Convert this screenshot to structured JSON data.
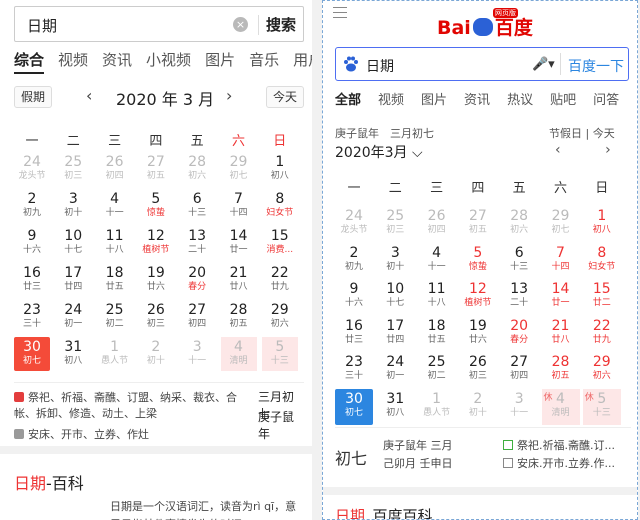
{
  "left": {
    "search": {
      "query": "日期",
      "clear_icon": "×",
      "button": "搜索"
    },
    "tabs": [
      "综合",
      "视频",
      "资讯",
      "小视频",
      "图片",
      "音乐",
      "用户"
    ],
    "calendar": {
      "holiday_button": "假期",
      "month_label": "2020 年 3 月",
      "prev": "‹",
      "next": "›",
      "today_button": "今天",
      "weekdays": [
        "一",
        "二",
        "三",
        "四",
        "五",
        "六",
        "日"
      ],
      "days": [
        {
          "n": "24",
          "s": "龙头节",
          "gray": true
        },
        {
          "n": "25",
          "s": "初三",
          "gray": true
        },
        {
          "n": "26",
          "s": "初四",
          "gray": true
        },
        {
          "n": "27",
          "s": "初五",
          "gray": true
        },
        {
          "n": "28",
          "s": "初六",
          "gray": true
        },
        {
          "n": "29",
          "s": "初七",
          "gray": true
        },
        {
          "n": "1",
          "s": "初八"
        },
        {
          "n": "2",
          "s": "初九"
        },
        {
          "n": "3",
          "s": "初十"
        },
        {
          "n": "4",
          "s": "十一"
        },
        {
          "n": "5",
          "s": "惊蛰",
          "sred": true
        },
        {
          "n": "6",
          "s": "十三"
        },
        {
          "n": "7",
          "s": "十四"
        },
        {
          "n": "8",
          "s": "妇女节",
          "sred": true
        },
        {
          "n": "9",
          "s": "十六"
        },
        {
          "n": "10",
          "s": "十七"
        },
        {
          "n": "11",
          "s": "十八"
        },
        {
          "n": "12",
          "s": "植树节",
          "sred": true
        },
        {
          "n": "13",
          "s": "二十"
        },
        {
          "n": "14",
          "s": "廿一"
        },
        {
          "n": "15",
          "s": "消费...",
          "sred": true
        },
        {
          "n": "16",
          "s": "廿三"
        },
        {
          "n": "17",
          "s": "廿四"
        },
        {
          "n": "18",
          "s": "廿五"
        },
        {
          "n": "19",
          "s": "廿六"
        },
        {
          "n": "20",
          "s": "春分",
          "sred": true
        },
        {
          "n": "21",
          "s": "廿八"
        },
        {
          "n": "22",
          "s": "廿九"
        },
        {
          "n": "23",
          "s": "三十"
        },
        {
          "n": "24",
          "s": "初一"
        },
        {
          "n": "25",
          "s": "初二"
        },
        {
          "n": "26",
          "s": "初三"
        },
        {
          "n": "27",
          "s": "初四"
        },
        {
          "n": "28",
          "s": "初五"
        },
        {
          "n": "29",
          "s": "初六"
        },
        {
          "n": "30",
          "s": "初七",
          "sel": true
        },
        {
          "n": "31",
          "s": "初八"
        },
        {
          "n": "1",
          "s": "愚人节",
          "gray": true
        },
        {
          "n": "2",
          "s": "初十",
          "gray": true
        },
        {
          "n": "3",
          "s": "十一",
          "gray": true
        },
        {
          "n": "4",
          "s": "清明",
          "gray": true,
          "hol": true
        },
        {
          "n": "5",
          "s": "十三",
          "gray": true,
          "hol": true
        }
      ]
    },
    "info": {
      "yi_text": "祭祀、祈福、斋醮、订盟、纳采、裁衣、合帐、拆卸、修造、动土、上梁",
      "ji_text": "安床、开市、立券、作灶",
      "lunar": "三月初七",
      "ganzhi": "庚子鼠年",
      "yi_color": "#e33d3d",
      "ji_color": "#9a9a9a"
    },
    "baike": {
      "highlight": "日期",
      "rest": "-百科",
      "desc": "日期是一个汉语词汇，读音为rì qī，意思是指某件事情发生的时间"
    }
  },
  "right": {
    "logo": {
      "text_a": "Bai",
      "text_b": "百度",
      "badge": "网页版"
    },
    "search": {
      "query": "日期",
      "mic": "🎤▾",
      "button": "百度一下"
    },
    "tabs": [
      "全部",
      "视频",
      "图片",
      "资讯",
      "热议",
      "贴吧",
      "问答"
    ],
    "calendar": {
      "lunar_line": "庚子鼠年　三月初七",
      "holiday_link": "节假日",
      "today_link": "今天",
      "month_label": "2020年3月",
      "prev": "‹",
      "next": "›",
      "weekdays": [
        "一",
        "二",
        "三",
        "四",
        "五",
        "六",
        "日"
      ],
      "days": [
        {
          "n": "24",
          "s": "龙头节",
          "gray": true
        },
        {
          "n": "25",
          "s": "初三",
          "gray": true
        },
        {
          "n": "26",
          "s": "初四",
          "gray": true
        },
        {
          "n": "27",
          "s": "初五",
          "gray": true
        },
        {
          "n": "28",
          "s": "初六",
          "gray": true
        },
        {
          "n": "29",
          "s": "初七",
          "gray": true
        },
        {
          "n": "1",
          "s": "初八",
          "red": true
        },
        {
          "n": "2",
          "s": "初九"
        },
        {
          "n": "3",
          "s": "初十"
        },
        {
          "n": "4",
          "s": "十一"
        },
        {
          "n": "5",
          "s": "惊蛰",
          "red": true
        },
        {
          "n": "6",
          "s": "十三"
        },
        {
          "n": "7",
          "s": "十四",
          "red": true
        },
        {
          "n": "8",
          "s": "妇女节",
          "red": true
        },
        {
          "n": "9",
          "s": "十六"
        },
        {
          "n": "10",
          "s": "十七"
        },
        {
          "n": "11",
          "s": "十八"
        },
        {
          "n": "12",
          "s": "植树节",
          "red": true
        },
        {
          "n": "13",
          "s": "二十"
        },
        {
          "n": "14",
          "s": "廿一",
          "red": true
        },
        {
          "n": "15",
          "s": "廿二",
          "red": true
        },
        {
          "n": "16",
          "s": "廿三"
        },
        {
          "n": "17",
          "s": "廿四"
        },
        {
          "n": "18",
          "s": "廿五"
        },
        {
          "n": "19",
          "s": "廿六"
        },
        {
          "n": "20",
          "s": "春分",
          "red": true
        },
        {
          "n": "21",
          "s": "廿八",
          "red": true
        },
        {
          "n": "22",
          "s": "廿九",
          "red": true
        },
        {
          "n": "23",
          "s": "三十"
        },
        {
          "n": "24",
          "s": "初一"
        },
        {
          "n": "25",
          "s": "初二"
        },
        {
          "n": "26",
          "s": "初三"
        },
        {
          "n": "27",
          "s": "初四"
        },
        {
          "n": "28",
          "s": "初五",
          "red": true
        },
        {
          "n": "29",
          "s": "初六",
          "red": true
        },
        {
          "n": "30",
          "s": "初七",
          "sel": true
        },
        {
          "n": "31",
          "s": "初八"
        },
        {
          "n": "1",
          "s": "愚人节",
          "gray": true
        },
        {
          "n": "2",
          "s": "初十",
          "gray": true
        },
        {
          "n": "3",
          "s": "十一",
          "gray": true
        },
        {
          "n": "4",
          "s": "清明",
          "gray": true,
          "hol": true,
          "tag": "休"
        },
        {
          "n": "5",
          "s": "十三",
          "gray": true,
          "hol": true,
          "tag": "休"
        }
      ]
    },
    "bottom": {
      "big": "初七",
      "line1": "庚子鼠年 三月",
      "line2": "己卯月 壬申日",
      "yi": "祭祀.祈福.斋醮.订...",
      "ji": "安床.开市.立券.作...",
      "yi_color": "#3fae3f",
      "ji_color": "#888888"
    },
    "baike": {
      "highlight": "日期",
      "rest": "_百度百科"
    }
  }
}
